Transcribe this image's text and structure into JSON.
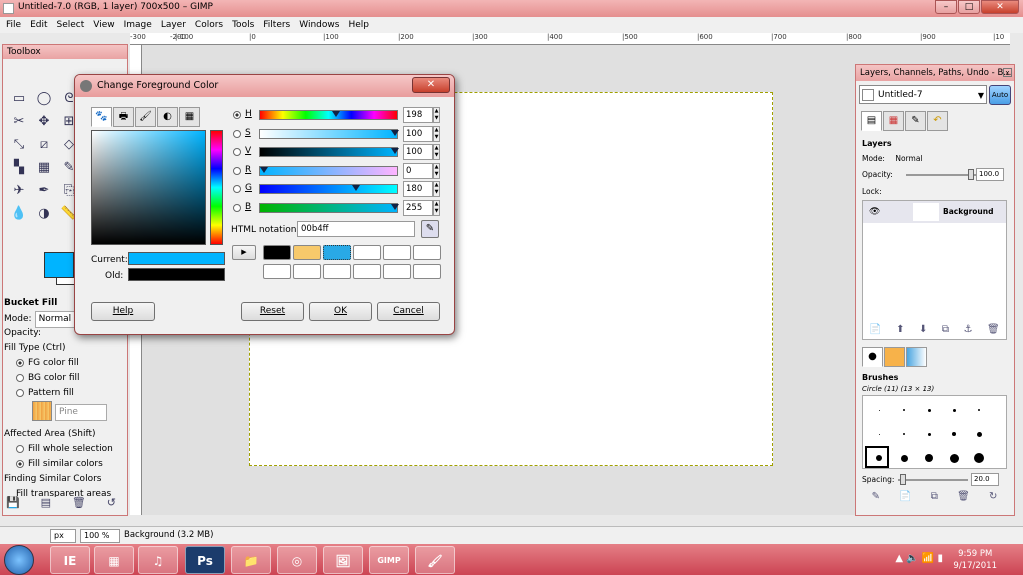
{
  "window": {
    "title": "Untitled-7.0 (RGB, 1 layer) 700x500 – GIMP",
    "minimize": "–",
    "maximize": "□",
    "close": "✕"
  },
  "menu": [
    "File",
    "Edit",
    "Select",
    "View",
    "Image",
    "Layer",
    "Colors",
    "Tools",
    "Filters",
    "Windows",
    "Help"
  ],
  "ruler_ticks": [
    "-300",
    "-200",
    "|-100",
    "|0",
    "|100",
    "|200",
    "|300",
    "|400",
    "|500",
    "|600",
    "|700",
    "|800",
    "|900",
    "|10"
  ],
  "toolbox": {
    "title": "Toolbox",
    "tool_icons": [
      "rect-select-icon",
      "ellipse-select-icon",
      "free-select-icon",
      "fuzzy-select-icon",
      "color-select-icon",
      "scissors-icon",
      "move-icon",
      "align-icon",
      "crop-icon",
      "rotate-icon",
      "scale-icon",
      "shear-icon",
      "perspective-icon",
      "flip-icon",
      "text-icon",
      "bucket-fill-icon",
      "blend-icon",
      "pencil-icon",
      "paintbrush-icon",
      "eraser-icon",
      "airbrush-icon",
      "ink-icon",
      "clone-icon",
      "heal-icon",
      "smudge-icon",
      "blur-icon",
      "dodge-icon",
      "measure-icon"
    ],
    "tool_glyphs": [
      "▭",
      "◯",
      "ᘓ",
      "✦",
      "◈",
      "✂",
      "✥",
      "⊞",
      "⌗",
      "↻",
      "⤡",
      "⧄",
      "◇",
      "⇋",
      "A",
      "▚",
      "▦",
      "✎",
      "🖌",
      "▱",
      "✈",
      "✒",
      "⎘",
      "✚",
      "☝",
      "💧",
      "◑",
      "📏"
    ],
    "fg_color": "#00b4ff",
    "bg_color": "#ffffff",
    "tool_options_title": "Bucket Fill",
    "mode_label": "Mode:",
    "mode_value": "Normal",
    "opacity_label": "Opacity:",
    "fill_type_label": "Fill Type  (Ctrl)",
    "fill_fg": "FG color fill",
    "fill_bg": "BG color fill",
    "fill_pattern": "Pattern fill",
    "pattern_name": "Pine",
    "affected_area_label": "Affected Area  (Shift)",
    "fill_whole": "Fill whole selection",
    "fill_similar": "Fill similar colors",
    "finding_label": "Finding Similar Colors",
    "fill_transparent": "Fill transparent areas",
    "bottom_icons": [
      "💾",
      "▤",
      "🗑",
      "↺"
    ]
  },
  "dialog": {
    "title": "Change Foreground Color",
    "close": "✕",
    "tab_icons": [
      "gimp-wilber-icon",
      "cmyk-icon",
      "watercolor-icon",
      "color-wheel-icon",
      "palette-icon"
    ],
    "tab_glyphs": [
      "🐾",
      "🖶",
      "🖌",
      "◐",
      "▦"
    ],
    "sliders": [
      {
        "label": "H",
        "value": "198",
        "selected": true
      },
      {
        "label": "S",
        "value": "100",
        "selected": false
      },
      {
        "label": "V",
        "value": "100",
        "selected": false
      },
      {
        "label": "R",
        "value": "0",
        "selected": false
      },
      {
        "label": "G",
        "value": "180",
        "selected": false
      },
      {
        "label": "B",
        "value": "255",
        "selected": false
      }
    ],
    "slider_positions": [
      0.55,
      1.0,
      1.0,
      0.0,
      0.706,
      1.0
    ],
    "html_notation_label": "HTML notation:",
    "html_notation_value": "00b4ff",
    "current_label": "Current:",
    "old_label": "Old:",
    "current_color": "#00b4ff",
    "old_color": "#000000",
    "history_colors": [
      "#000000",
      "#f7c96b",
      "#29a9e6",
      "#ffffff",
      "#ffffff",
      "#ffffff",
      "#ffffff",
      "#ffffff",
      "#ffffff",
      "#ffffff",
      "#ffffff",
      "#ffffff"
    ],
    "history_arrow": "▶",
    "help": "Help",
    "reset": "Reset",
    "ok": "OK",
    "cancel": "Cancel"
  },
  "dock": {
    "title": "Layers, Channels, Paths, Undo - B...",
    "image_name": "Untitled-7",
    "auto": "Auto",
    "layers_title": "Layers",
    "mode_label": "Mode:",
    "mode_value": "Normal",
    "opacity_label": "Opacity:",
    "opacity_value": "100.0",
    "lock_label": "Lock:",
    "layer_name": "Background",
    "layer_icons": [
      "📄",
      "⬆",
      "⬇",
      "⧉",
      "⚓",
      "🗑"
    ],
    "brushes_title": "Brushes",
    "brush_name": "Circle (11) (13 × 13)",
    "spacing_label": "Spacing:",
    "spacing_value": "20.0",
    "brush_icons": [
      "✎",
      "📄",
      "⧉",
      "🗑",
      "↻"
    ]
  },
  "statusbar": {
    "unit": "px",
    "zoom": "100 %",
    "message": "Background (3.2 MB)"
  },
  "taskbar": {
    "apps": [
      "IE",
      "▦",
      "♫",
      "Ps",
      "📁",
      "◎",
      "🖼",
      "GIMP",
      "🖌"
    ],
    "time": "9:59 PM",
    "date": "9/17/2011",
    "tray": "▲ 🔈 📶 ▮"
  }
}
